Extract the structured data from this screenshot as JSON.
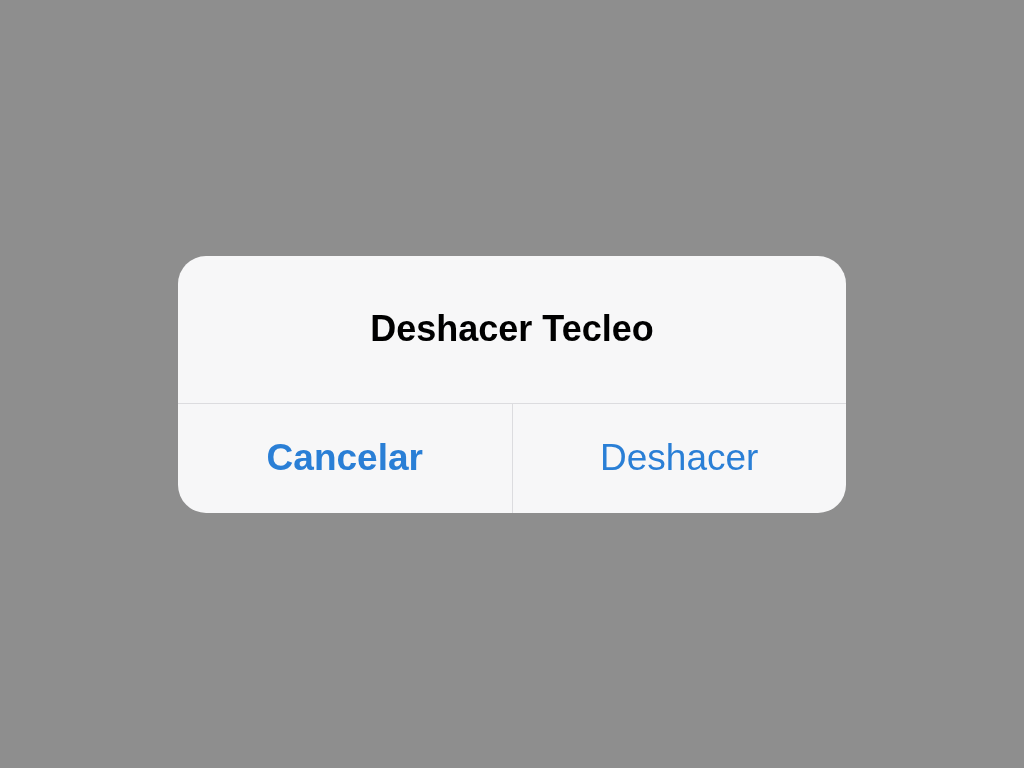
{
  "dialog": {
    "title": "Deshacer Tecleo",
    "buttons": [
      {
        "label": "Cancelar",
        "kind": "cancel"
      },
      {
        "label": "Deshacer",
        "kind": "default"
      }
    ]
  }
}
